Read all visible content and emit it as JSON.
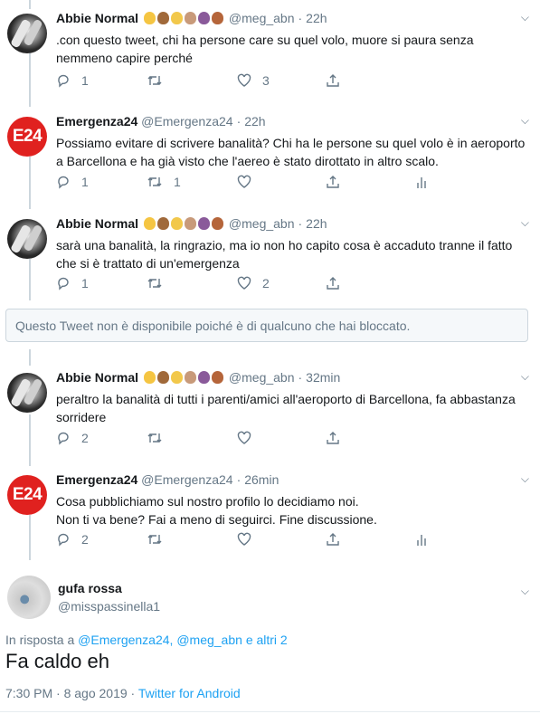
{
  "tweets": [
    {
      "name": "Abbie Normal",
      "handle": "@meg_abn",
      "time": "22h",
      "text": ".con questo tweet, chi ha persone care su quel volo, muore si paura senza nemmeno capire perché",
      "replies": "1",
      "retweets": "",
      "likes": "3"
    },
    {
      "name": "Emergenza24",
      "handle": "@Emergenza24",
      "time": "22h",
      "text": "Possiamo evitare di scrivere banalità? Chi ha le persone su quel volo è in aeroporto a Barcellona e ha già visto che l'aereo è stato dirottato in altro scalo.",
      "replies": "1",
      "retweets": "1",
      "likes": ""
    },
    {
      "name": "Abbie Normal",
      "handle": "@meg_abn",
      "time": "22h",
      "text": "sarà una banalità, la ringrazio, ma io non ho capito cosa è accaduto tranne il fatto che si è trattato di un'emergenza",
      "replies": "1",
      "retweets": "",
      "likes": "2"
    },
    {
      "name": "Abbie Normal",
      "handle": "@meg_abn",
      "time": "32min",
      "text": "peraltro la banalità di tutti i parenti/amici all'aeroporto di Barcellona, fa abbastanza sorridere",
      "replies": "2",
      "retweets": "",
      "likes": ""
    },
    {
      "name": "Emergenza24",
      "handle": "@Emergenza24",
      "time": "26min",
      "text_line1": "Cosa pubblichiamo sul nostro profilo lo decidiamo noi.",
      "text_line2": "Non ti va bene? Fai a meno di seguirci. Fine discussione.",
      "replies": "2",
      "retweets": "",
      "likes": ""
    }
  ],
  "blocked_notice": "Questo Tweet non è disponibile poiché è di qualcuno che hai bloccato.",
  "avatar_text": "E24",
  "main_tweet": {
    "name": "gufa rossa",
    "handle": "@misspassinella1",
    "reply_prefix": "In risposta a",
    "reply_to_1": "@Emergenza24,",
    "reply_to_2": "@meg_abn",
    "reply_suffix": "e altri 2",
    "text": "Fa caldo eh",
    "timestamp": "7:30 PM · 8 ago 2019 ·",
    "source": "Twitter for Android"
  },
  "colors": {
    "accent": "#1da1f2",
    "muted": "#657786",
    "e24_red": "#e0211f"
  },
  "icons": [
    "reply-icon",
    "retweet-icon",
    "like-icon",
    "share-icon",
    "analytics-icon",
    "chevron-down-icon"
  ]
}
